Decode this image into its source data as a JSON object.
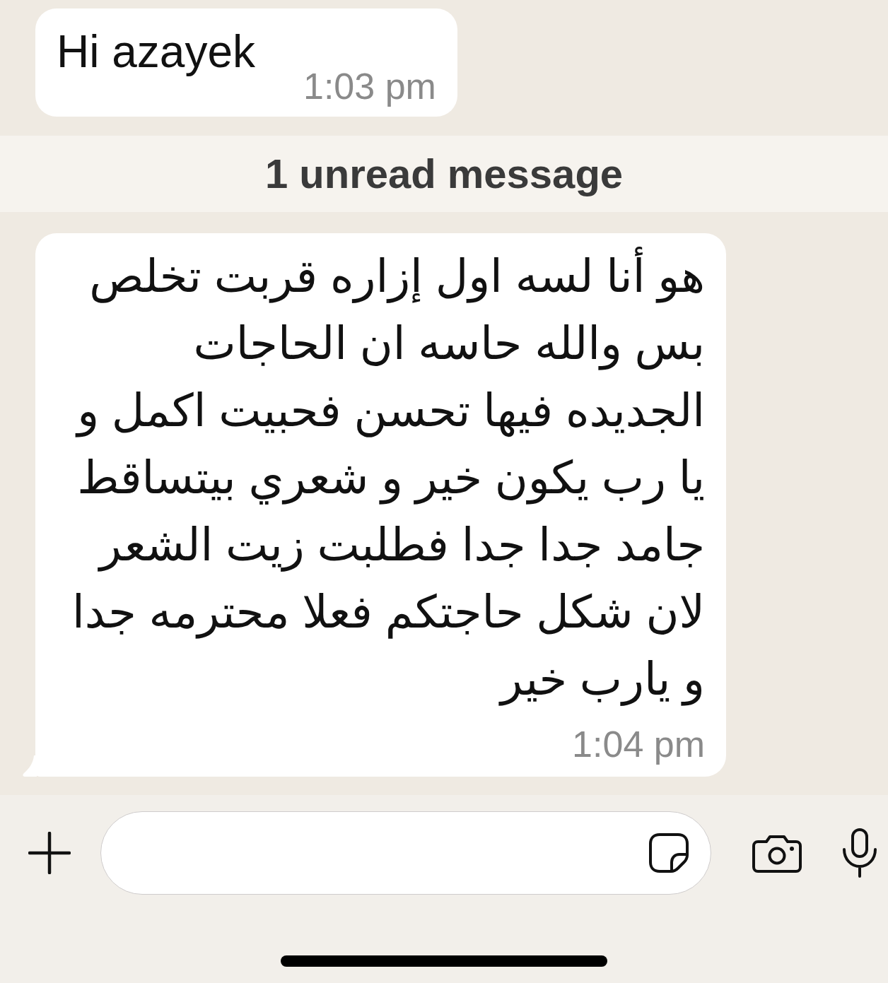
{
  "chat": [
    {
      "kind": "message",
      "text": "Hi azayek",
      "time": "1:03 pm",
      "tail": false
    },
    {
      "kind": "unread_divider",
      "text": "1 unread message"
    },
    {
      "kind": "message",
      "text": "هو أنا لسه اول إزاره قربت تخلص\nبس والله حاسه ان الحاجات\nالجديده فيها تحسن فحبيت اكمل و\nيا رب يكون خير و شعري بيتساقط\nجامد جدا جدا فطلبت زيت الشعر\nلان شكل حاجتكم فعلا محترمه جدا\nو يارب خير",
      "time": "1:04 pm",
      "tail": true
    }
  ]
}
